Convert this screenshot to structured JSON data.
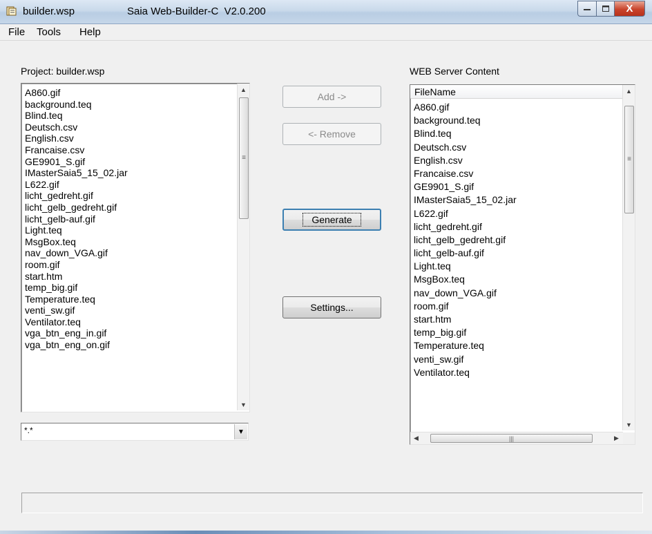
{
  "window": {
    "title": "builder.wsp",
    "app_name": "Saia Web-Builder-C  V2.0.200",
    "buttons": {
      "minimize": "—",
      "maximize": "□",
      "close": "X"
    }
  },
  "menu": [
    "File",
    "Tools",
    "Help"
  ],
  "project": {
    "label": "Project: builder.wsp",
    "files": [
      "A860.gif",
      "background.teq",
      "Blind.teq",
      "Deutsch.csv",
      "English.csv",
      "Francaise.csv",
      "GE9901_S.gif",
      "IMasterSaia5_15_02.jar",
      "L622.gif",
      "licht_gedreht.gif",
      "licht_gelb_gedreht.gif",
      "licht_gelb-auf.gif",
      "Light.teq",
      "MsgBox.teq",
      "nav_down_VGA.gif",
      "room.gif",
      "start.htm",
      "temp_big.gif",
      "Temperature.teq",
      "venti_sw.gif",
      "Ventilator.teq",
      "vga_btn_eng_in.gif",
      "vga_btn_eng_on.gif"
    ],
    "filter_value": "*.*"
  },
  "buttons": {
    "add": "Add ->",
    "remove": "<- Remove",
    "generate": "Generate",
    "settings": "Settings..."
  },
  "server": {
    "label": "WEB Server Content",
    "column_header": "FileName",
    "files": [
      "A860.gif",
      "background.teq",
      "Blind.teq",
      "Deutsch.csv",
      "English.csv",
      "Francaise.csv",
      "GE9901_S.gif",
      "IMasterSaia5_15_02.jar",
      "L622.gif",
      "licht_gedreht.gif",
      "licht_gelb_gedreht.gif",
      "licht_gelb-auf.gif",
      "Light.teq",
      "MsgBox.teq",
      "nav_down_VGA.gif",
      "room.gif",
      "start.htm",
      "temp_big.gif",
      "Temperature.teq",
      "venti_sw.gif",
      "Ventilator.teq"
    ]
  },
  "status": {
    "text": ""
  }
}
